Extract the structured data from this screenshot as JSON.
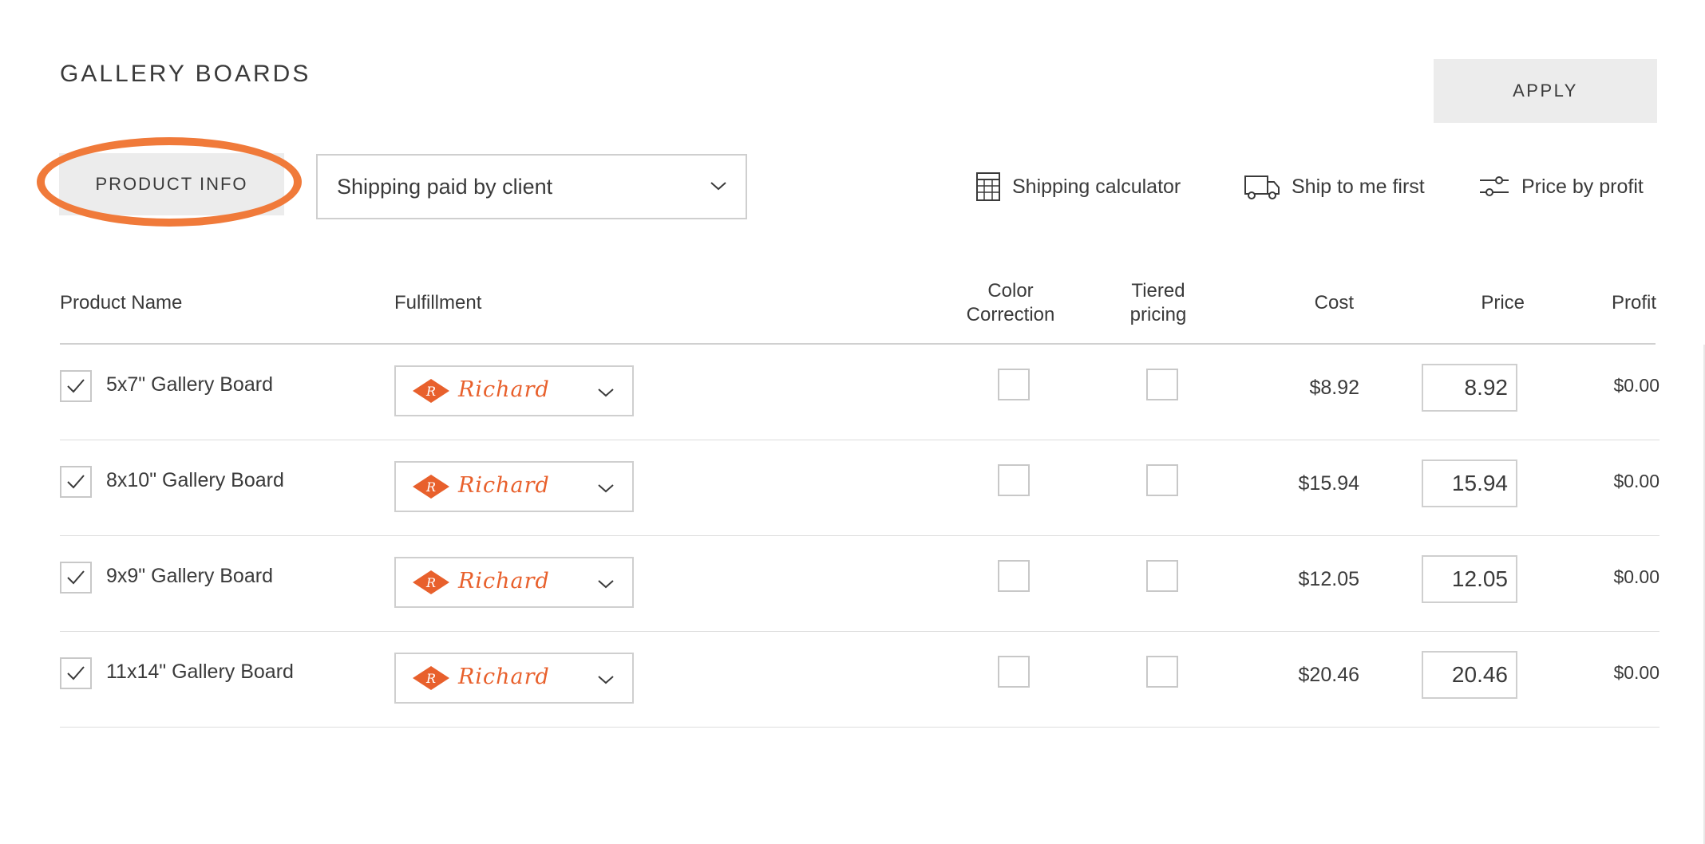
{
  "page": {
    "title": "GALLERY BOARDS",
    "apply_label": "APPLY",
    "product_info_label": "PRODUCT INFO",
    "shipping_select_value": "Shipping paid by client",
    "highlight_color": "#f07a3a",
    "accent_color": "#e8602c"
  },
  "tools": {
    "shipping_calculator": {
      "label": "Shipping calculator",
      "icon": "calculator-icon"
    },
    "ship_to_me": {
      "label": "Ship to me first",
      "icon": "truck-icon"
    },
    "price_by_profit": {
      "label": "Price by profit",
      "icon": "sliders-icon"
    }
  },
  "table": {
    "headers": {
      "product_name": "Product Name",
      "fulfillment": "Fulfillment",
      "color_correction_1": "Color",
      "color_correction_2": "Correction",
      "tiered_pricing_1": "Tiered",
      "tiered_pricing_2": "pricing",
      "cost": "Cost",
      "price": "Price",
      "profit": "Profit"
    },
    "rows": [
      {
        "name": "5x7\" Gallery Board",
        "checked": true,
        "fulfillment": "Richard",
        "color_correction": false,
        "tiered": false,
        "cost": "$8.92",
        "price": "8.92",
        "profit": "$0.00"
      },
      {
        "name": "8x10\" Gallery Board",
        "checked": true,
        "fulfillment": "Richard",
        "color_correction": false,
        "tiered": false,
        "cost": "$15.94",
        "price": "15.94",
        "profit": "$0.00"
      },
      {
        "name": "9x9\" Gallery Board",
        "checked": true,
        "fulfillment": "Richard",
        "color_correction": false,
        "tiered": false,
        "cost": "$12.05",
        "price": "12.05",
        "profit": "$0.00"
      },
      {
        "name": "11x14\" Gallery Board",
        "checked": true,
        "fulfillment": "Richard",
        "color_correction": false,
        "tiered": false,
        "cost": "$20.46",
        "price": "20.46",
        "profit": "$0.00"
      }
    ]
  }
}
